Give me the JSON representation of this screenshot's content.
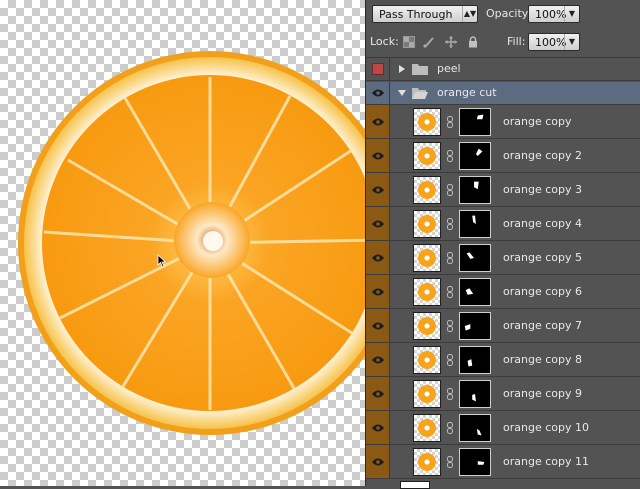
{
  "panel": {
    "blend_mode": "Pass Through",
    "opacity_label": "Opacity:",
    "opacity_value": "100%",
    "lock_label": "Lock:",
    "fill_label": "Fill:",
    "fill_value": "100%"
  },
  "groups": [
    {
      "name": "peel",
      "visible": false,
      "expanded": false
    },
    {
      "name": "orange cut",
      "visible": true,
      "expanded": true,
      "selected": true
    }
  ],
  "layers": [
    {
      "name": "orange copy"
    },
    {
      "name": "orange copy 2"
    },
    {
      "name": "orange copy 3"
    },
    {
      "name": "orange copy 4"
    },
    {
      "name": "orange copy 5"
    },
    {
      "name": "orange copy 6"
    },
    {
      "name": "orange copy 7"
    },
    {
      "name": "orange copy 8"
    },
    {
      "name": "orange copy 9"
    },
    {
      "name": "orange copy 10"
    },
    {
      "name": "orange copy 11"
    }
  ],
  "colors": {
    "visibility_column": "#8a5a14",
    "selected_row": "#5d6b80",
    "orange": "#f7a41c"
  }
}
